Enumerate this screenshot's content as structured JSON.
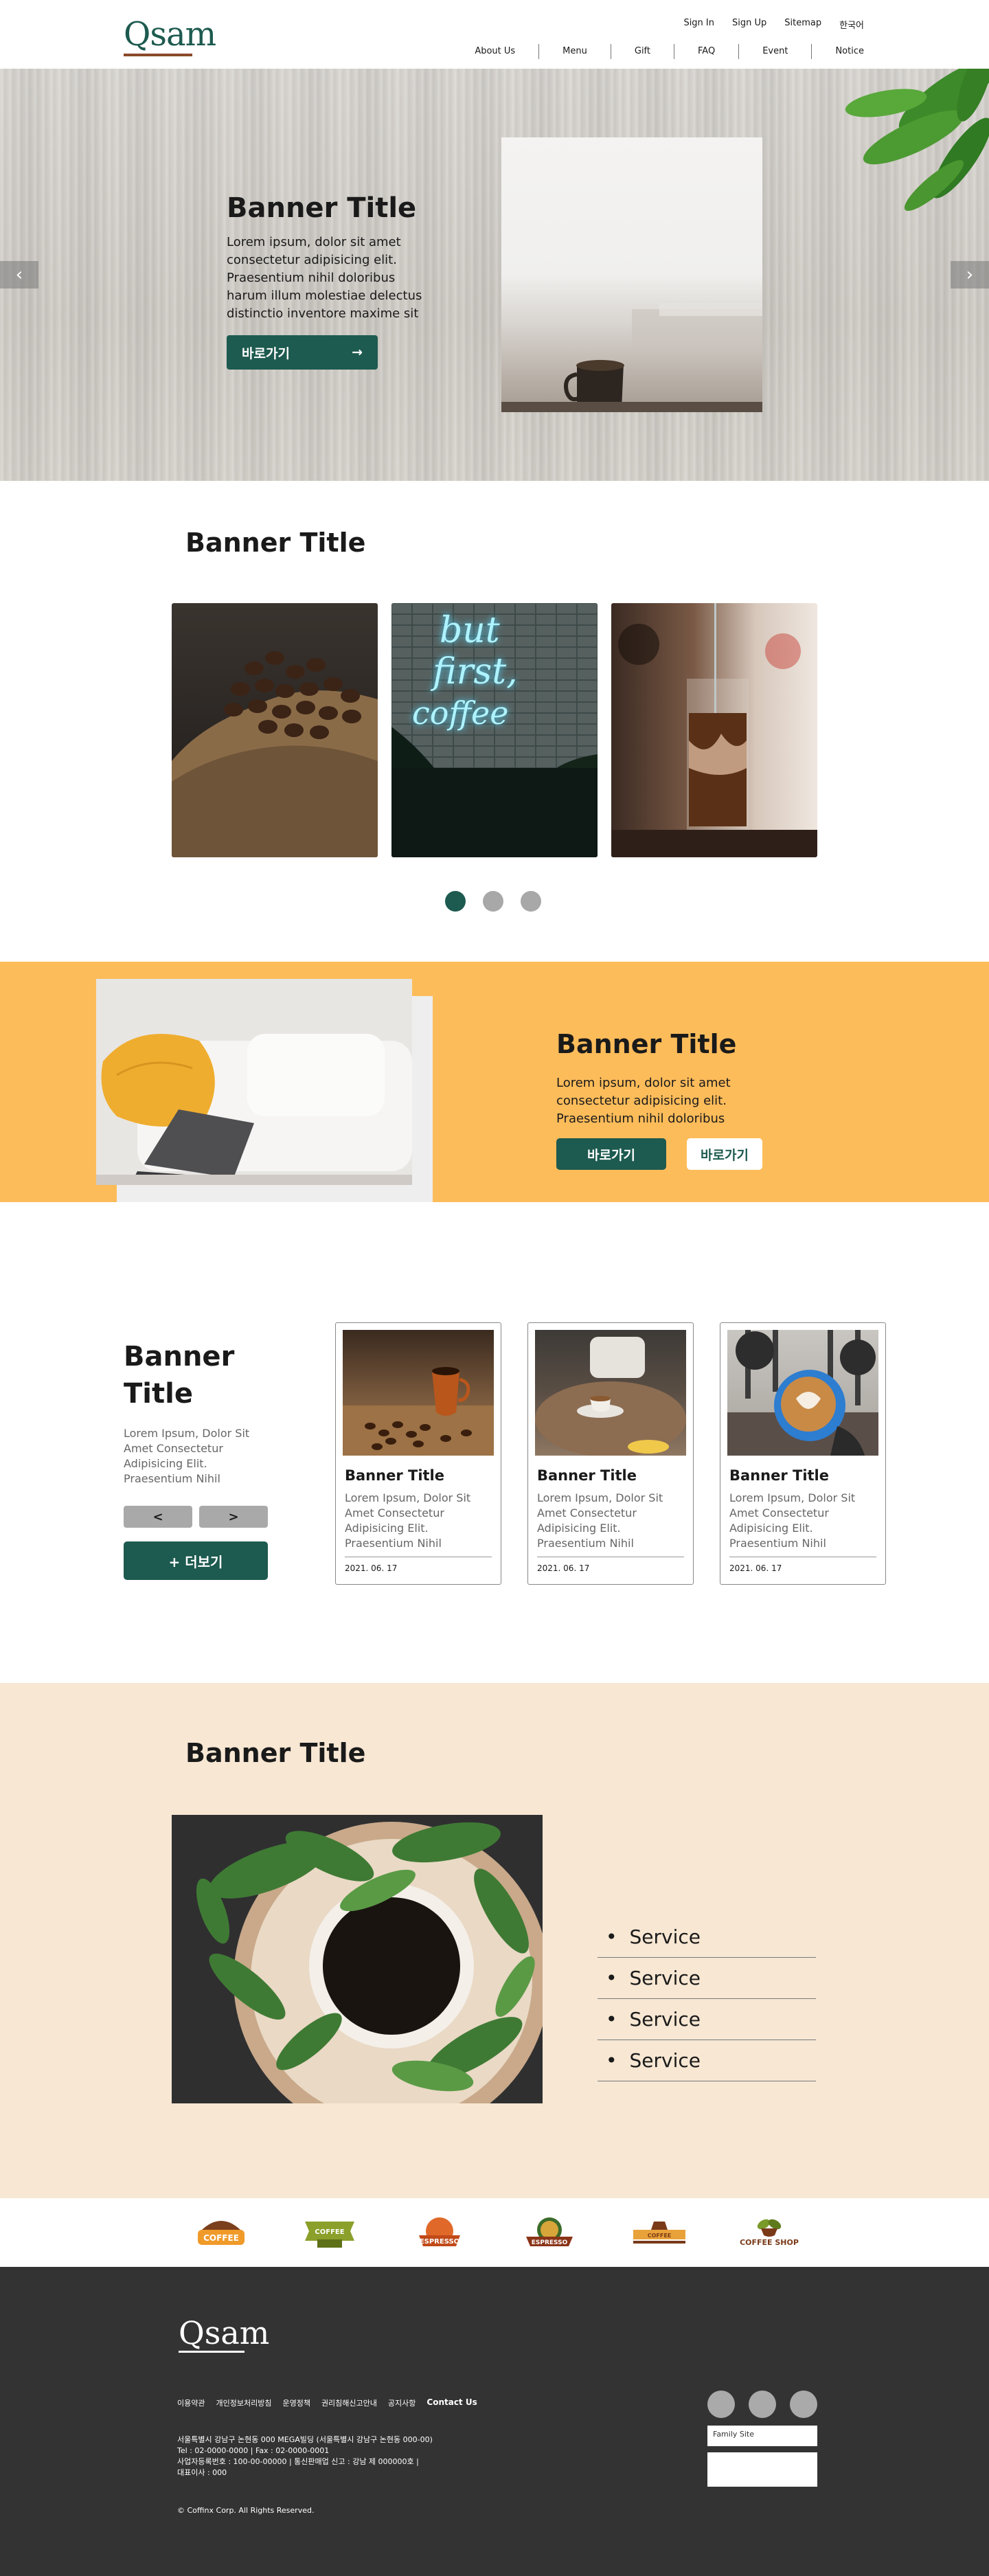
{
  "header": {
    "logo": "Qsam",
    "util_nav": [
      "Sign In",
      "Sign Up",
      "Sitemap",
      "한국어"
    ],
    "main_nav": [
      "About Us",
      "Menu",
      "Gift",
      "FAQ",
      "Event",
      "Notice"
    ]
  },
  "hero": {
    "title": "Banner Title",
    "text": "Lorem ipsum, dolor sit amet consectetur adipisicing elit. Praesentium nihil doloribus harum illum molestiae delectus distinctio inventore maxime sit",
    "button_label": "바로가기",
    "button_arrow": "→",
    "prev": "‹",
    "next": "›"
  },
  "gallery": {
    "title": "Banner Title",
    "neon_text": [
      "but",
      "first,",
      "coffee"
    ],
    "active_dot": 0
  },
  "promo": {
    "title": "Banner Title",
    "text": "Lorem ipsum, dolor sit amet consectetur adipisicing elit. Praesentium nihil doloribus",
    "button1": "바로가기",
    "button2": "바로가기"
  },
  "news": {
    "title": "Banner Title",
    "text": "Lorem Ipsum, Dolor Sit Amet Consectetur Adipisicing Elit. Praesentium Nihil",
    "prev": "<",
    "next": ">",
    "more": "+ 더보기",
    "cards": [
      {
        "title": "Banner Title",
        "text": "Lorem Ipsum, Dolor Sit Amet Consectetur Adipisicing Elit. Praesentium Nihil",
        "date": "2021. 06. 17"
      },
      {
        "title": "Banner Title",
        "text": "Lorem Ipsum, Dolor Sit Amet Consectetur Adipisicing Elit. Praesentium Nihil",
        "date": "2021. 06. 17"
      },
      {
        "title": "Banner Title",
        "text": "Lorem Ipsum, Dolor Sit Amet Consectetur Adipisicing Elit. Praesentium Nihil",
        "date": "2021. 06. 17"
      }
    ]
  },
  "services": {
    "title": "Banner Title",
    "items": [
      "Service",
      "Service",
      "Service",
      "Service"
    ]
  },
  "brands": [
    "COFFEE",
    "COFFEE",
    "ESPRESSO",
    "ESPRESSO",
    "COFFEE",
    "COFFEE SHOP"
  ],
  "footer": {
    "logo": "Qsam",
    "links": [
      "이용약관",
      "개인정보처리방침",
      "운영정책",
      "권리침해신고안내",
      "공지사항",
      "Contact Us"
    ],
    "info": [
      "서울특별시 강남구 논현동 000 MEGA빌딩 (서울특별시 강남구 논현동 000-00)",
      "Tel : 02-0000-0000  |  Fax : 02-0000-0001",
      "사업자등록번호 : 100-00-00000  |  통신판매업 신고 : 강남 제 000000호  |",
      "대표이사 : 000"
    ],
    "copyright": "© Coffinx Corp. All Rights Reserved.",
    "family_site": "Family Site"
  },
  "colors": {
    "brand_green": "#1d5a4f",
    "promo_orange": "#fdbc5a",
    "services_bg": "#f7e7d3",
    "footer_bg": "#333333"
  }
}
